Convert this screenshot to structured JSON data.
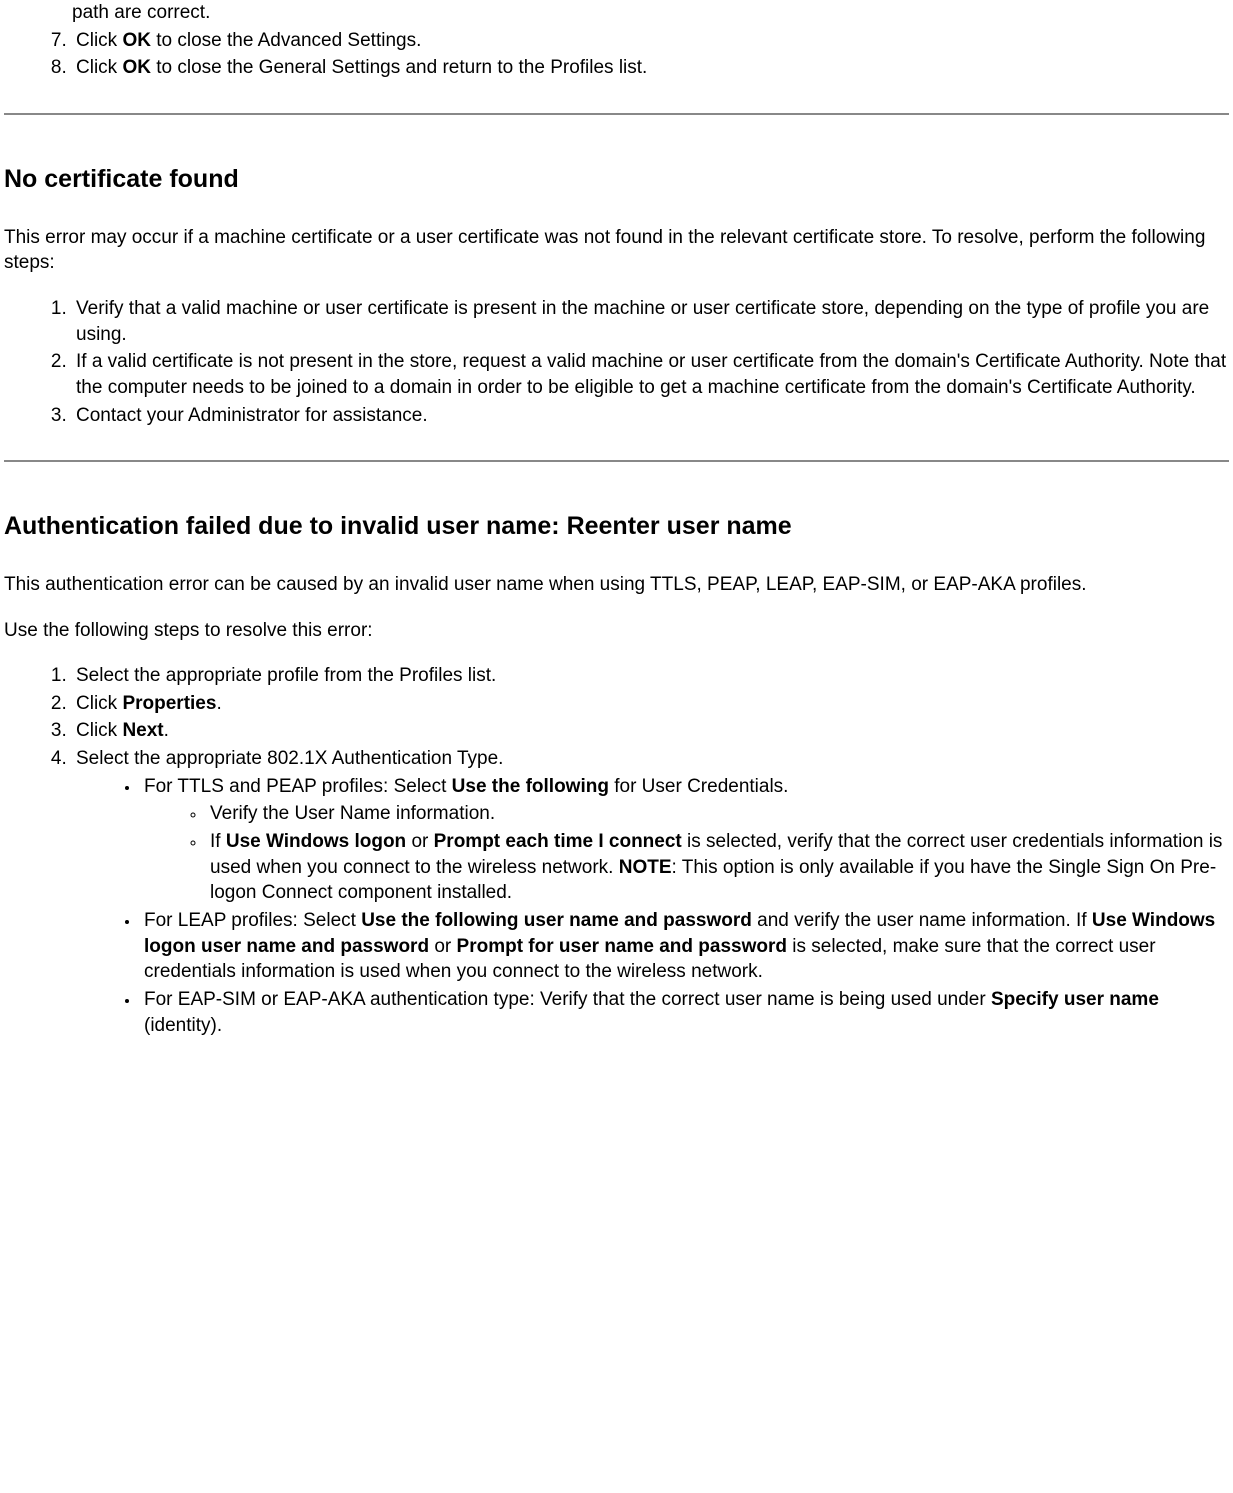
{
  "section0": {
    "frag": "path are correct.",
    "step7_a": "Click ",
    "step7_b": "OK",
    "step7_c": " to close the Advanced Settings.",
    "step8_a": "Click ",
    "step8_b": "OK",
    "step8_c": " to close the General Settings and return to the Profiles list."
  },
  "section1": {
    "heading": "No certificate found",
    "intro": "This error may occur if a machine certificate or a user certificate was not found in the relevant certificate store. To resolve, perform the following steps:",
    "step1": "Verify that a valid machine or user certificate is present in the machine or user certificate store, depending on the type of profile you are using.",
    "step2": "If a valid certificate is not present in the store, request a valid machine or user certificate from the domain's Certificate Authority. Note that the computer needs to be joined to a domain in order to be eligible to get a machine certificate from the domain's Certificate Authority.",
    "step3": "Contact your Administrator for assistance."
  },
  "section2": {
    "heading": "Authentication failed due to invalid user name: Reenter user name",
    "intro1": "This authentication error can be caused by an invalid user name when using TTLS, PEAP, LEAP, EAP-SIM, or EAP-AKA profiles.",
    "intro2": "Use the following steps to resolve this error:",
    "step1": "Select the appropriate profile from the Profiles list.",
    "step2_a": "Click ",
    "step2_b": "Properties",
    "step2_c": ".",
    "step3_a": "Click ",
    "step3_b": "Next",
    "step3_c": ".",
    "step4": "Select the appropriate 802.1X Authentication Type.",
    "b1_a": "For TTLS and PEAP profiles: Select ",
    "b1_b": "Use the following",
    "b1_c": " for User Credentials.",
    "b1_sub1": "Verify the User Name information.",
    "b1_sub2_a": "If ",
    "b1_sub2_b": "Use Windows logon",
    "b1_sub2_c": " or ",
    "b1_sub2_d": "Prompt each time I connect",
    "b1_sub2_e": " is selected, verify that the correct user credentials information is used when you connect to the wireless network. ",
    "b1_sub2_f": "NOTE",
    "b1_sub2_g": ": This option is only available if you have the Single Sign On Pre-logon Connect component installed.",
    "b2_a": "For LEAP profiles: Select ",
    "b2_b": "Use the following user name and password",
    "b2_c": " and verify the user name information. If ",
    "b2_d": "Use Windows logon user name and password",
    "b2_e": " or ",
    "b2_f": "Prompt for user name and password",
    "b2_g": " is selected, make sure that the correct user credentials information is used when you connect to the wireless network.",
    "b3_a": "For EAP-SIM or EAP-AKA authentication type: Verify that the correct user name is being used under ",
    "b3_b": "Specify user name",
    "b3_c": " (identity)."
  }
}
